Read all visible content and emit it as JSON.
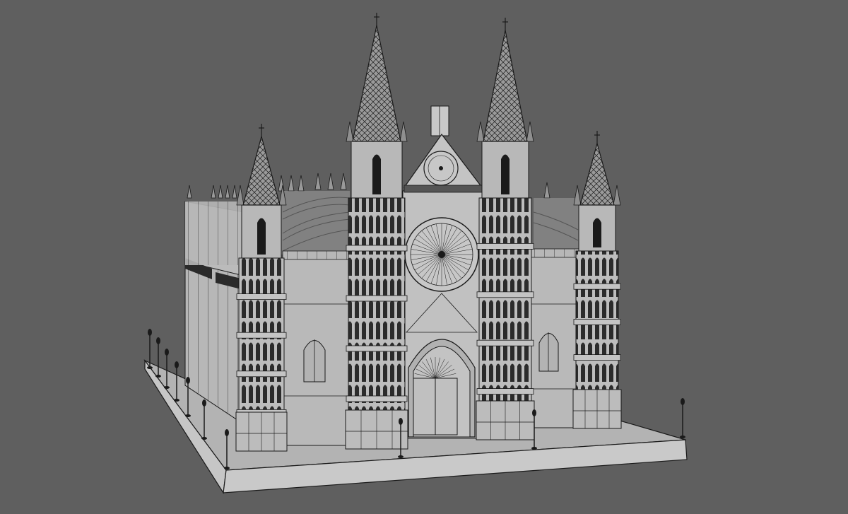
{
  "viewport": {
    "background_color": "#5f5f5f",
    "model_fill": "#bdbdbd",
    "model_fill_shadow": "#a9a9a9",
    "model_fill_dark": "#8c8c8c",
    "wire_color": "#1a1a1a",
    "ground_fill": "#b3b3b3",
    "ground_side_fill": "#c6c6c6"
  },
  "scene": {
    "subject": "cathedral-wireframe-model",
    "lamp_posts": 12,
    "towers": 4,
    "rose_windows": 2
  }
}
